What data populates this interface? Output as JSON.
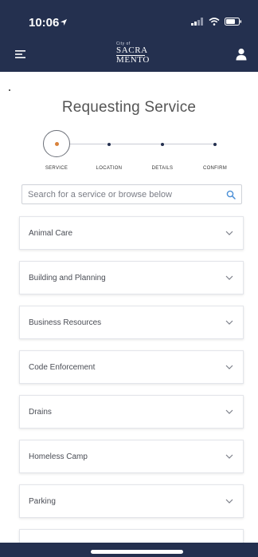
{
  "status": {
    "time": "10:06",
    "icons": [
      "location-arrow-icon",
      "signal-icon",
      "wifi-icon",
      "battery-icon"
    ]
  },
  "header": {
    "logo": {
      "small": "City of",
      "line1": "SACRA",
      "line2": "MENTO"
    },
    "icons": [
      "menu-icon",
      "user-icon"
    ]
  },
  "page": {
    "title": "Requesting Service"
  },
  "stepper": {
    "steps": [
      {
        "label": "SERVICE",
        "active": true
      },
      {
        "label": "LOCATION",
        "active": false
      },
      {
        "label": "DETAILS",
        "active": false
      },
      {
        "label": "CONFIRM",
        "active": false
      }
    ]
  },
  "search": {
    "value": "",
    "placeholder": "Search for a service or browse below"
  },
  "services": [
    {
      "label": "Animal Care"
    },
    {
      "label": "Building and Planning"
    },
    {
      "label": "Business Resources"
    },
    {
      "label": "Code Enforcement"
    },
    {
      "label": "Drains"
    },
    {
      "label": "Homeless Camp"
    },
    {
      "label": "Parking"
    },
    {
      "label": ""
    }
  ],
  "colors": {
    "brand": "#24304f",
    "active_step": "#d9823b",
    "accent_icon": "#4a8fd6"
  }
}
